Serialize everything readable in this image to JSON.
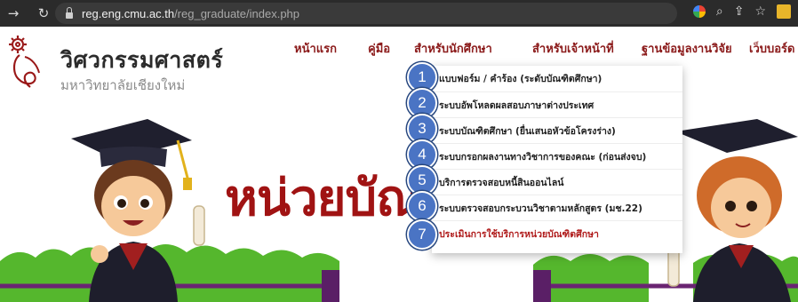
{
  "browser": {
    "url_host": "reg.eng.cmu.ac.th",
    "url_path": "/reg_graduate/index.php",
    "back_icon": "arrow-left-icon",
    "reload_icon": "reload-icon"
  },
  "header": {
    "brand": "วิศวกรรมศาสตร์",
    "brand_sub": "มหาวิทยาลัยเชียงใหม่"
  },
  "nav": {
    "items": [
      "หน้าแรก",
      "คู่มือ",
      "สำหรับนักศึกษา",
      "สำหรับเจ้าหน้าที่",
      "ฐานข้อมูลงานวิจัย",
      "เว็บบอร์ด"
    ]
  },
  "hero": {
    "title": "หน่วยบัณ"
  },
  "dropdown": {
    "items": [
      "แบบฟอร์ม / คำร้อง (ระดับบัณฑิตศึกษา)",
      "ระบบอัพโหลดผลสอบภาษาต่างประเทศ",
      "ระบบบัณฑิตศึกษา (ยื่นเสนอหัวข้อโครงร่าง)",
      "ระบบกรอกผลงานทางวิชาการของคณะ (ก่อนส่งจบ)",
      "บริการตรวจสอบหนี้สินออนไลน์",
      "ระบบตรวจสอบกระบวนวิชาตามหลักสูตร (มช.22)",
      "ประเมินการใช้บริการหน่วยบัณฑิตศึกษา"
    ],
    "badges": [
      "1",
      "2",
      "3",
      "4",
      "5",
      "6",
      "7"
    ]
  },
  "colors": {
    "nav_text": "#8b1a1a",
    "hero_title": "#a01313",
    "badge": "#4a74c4",
    "chrome": "#2b2b2b"
  }
}
